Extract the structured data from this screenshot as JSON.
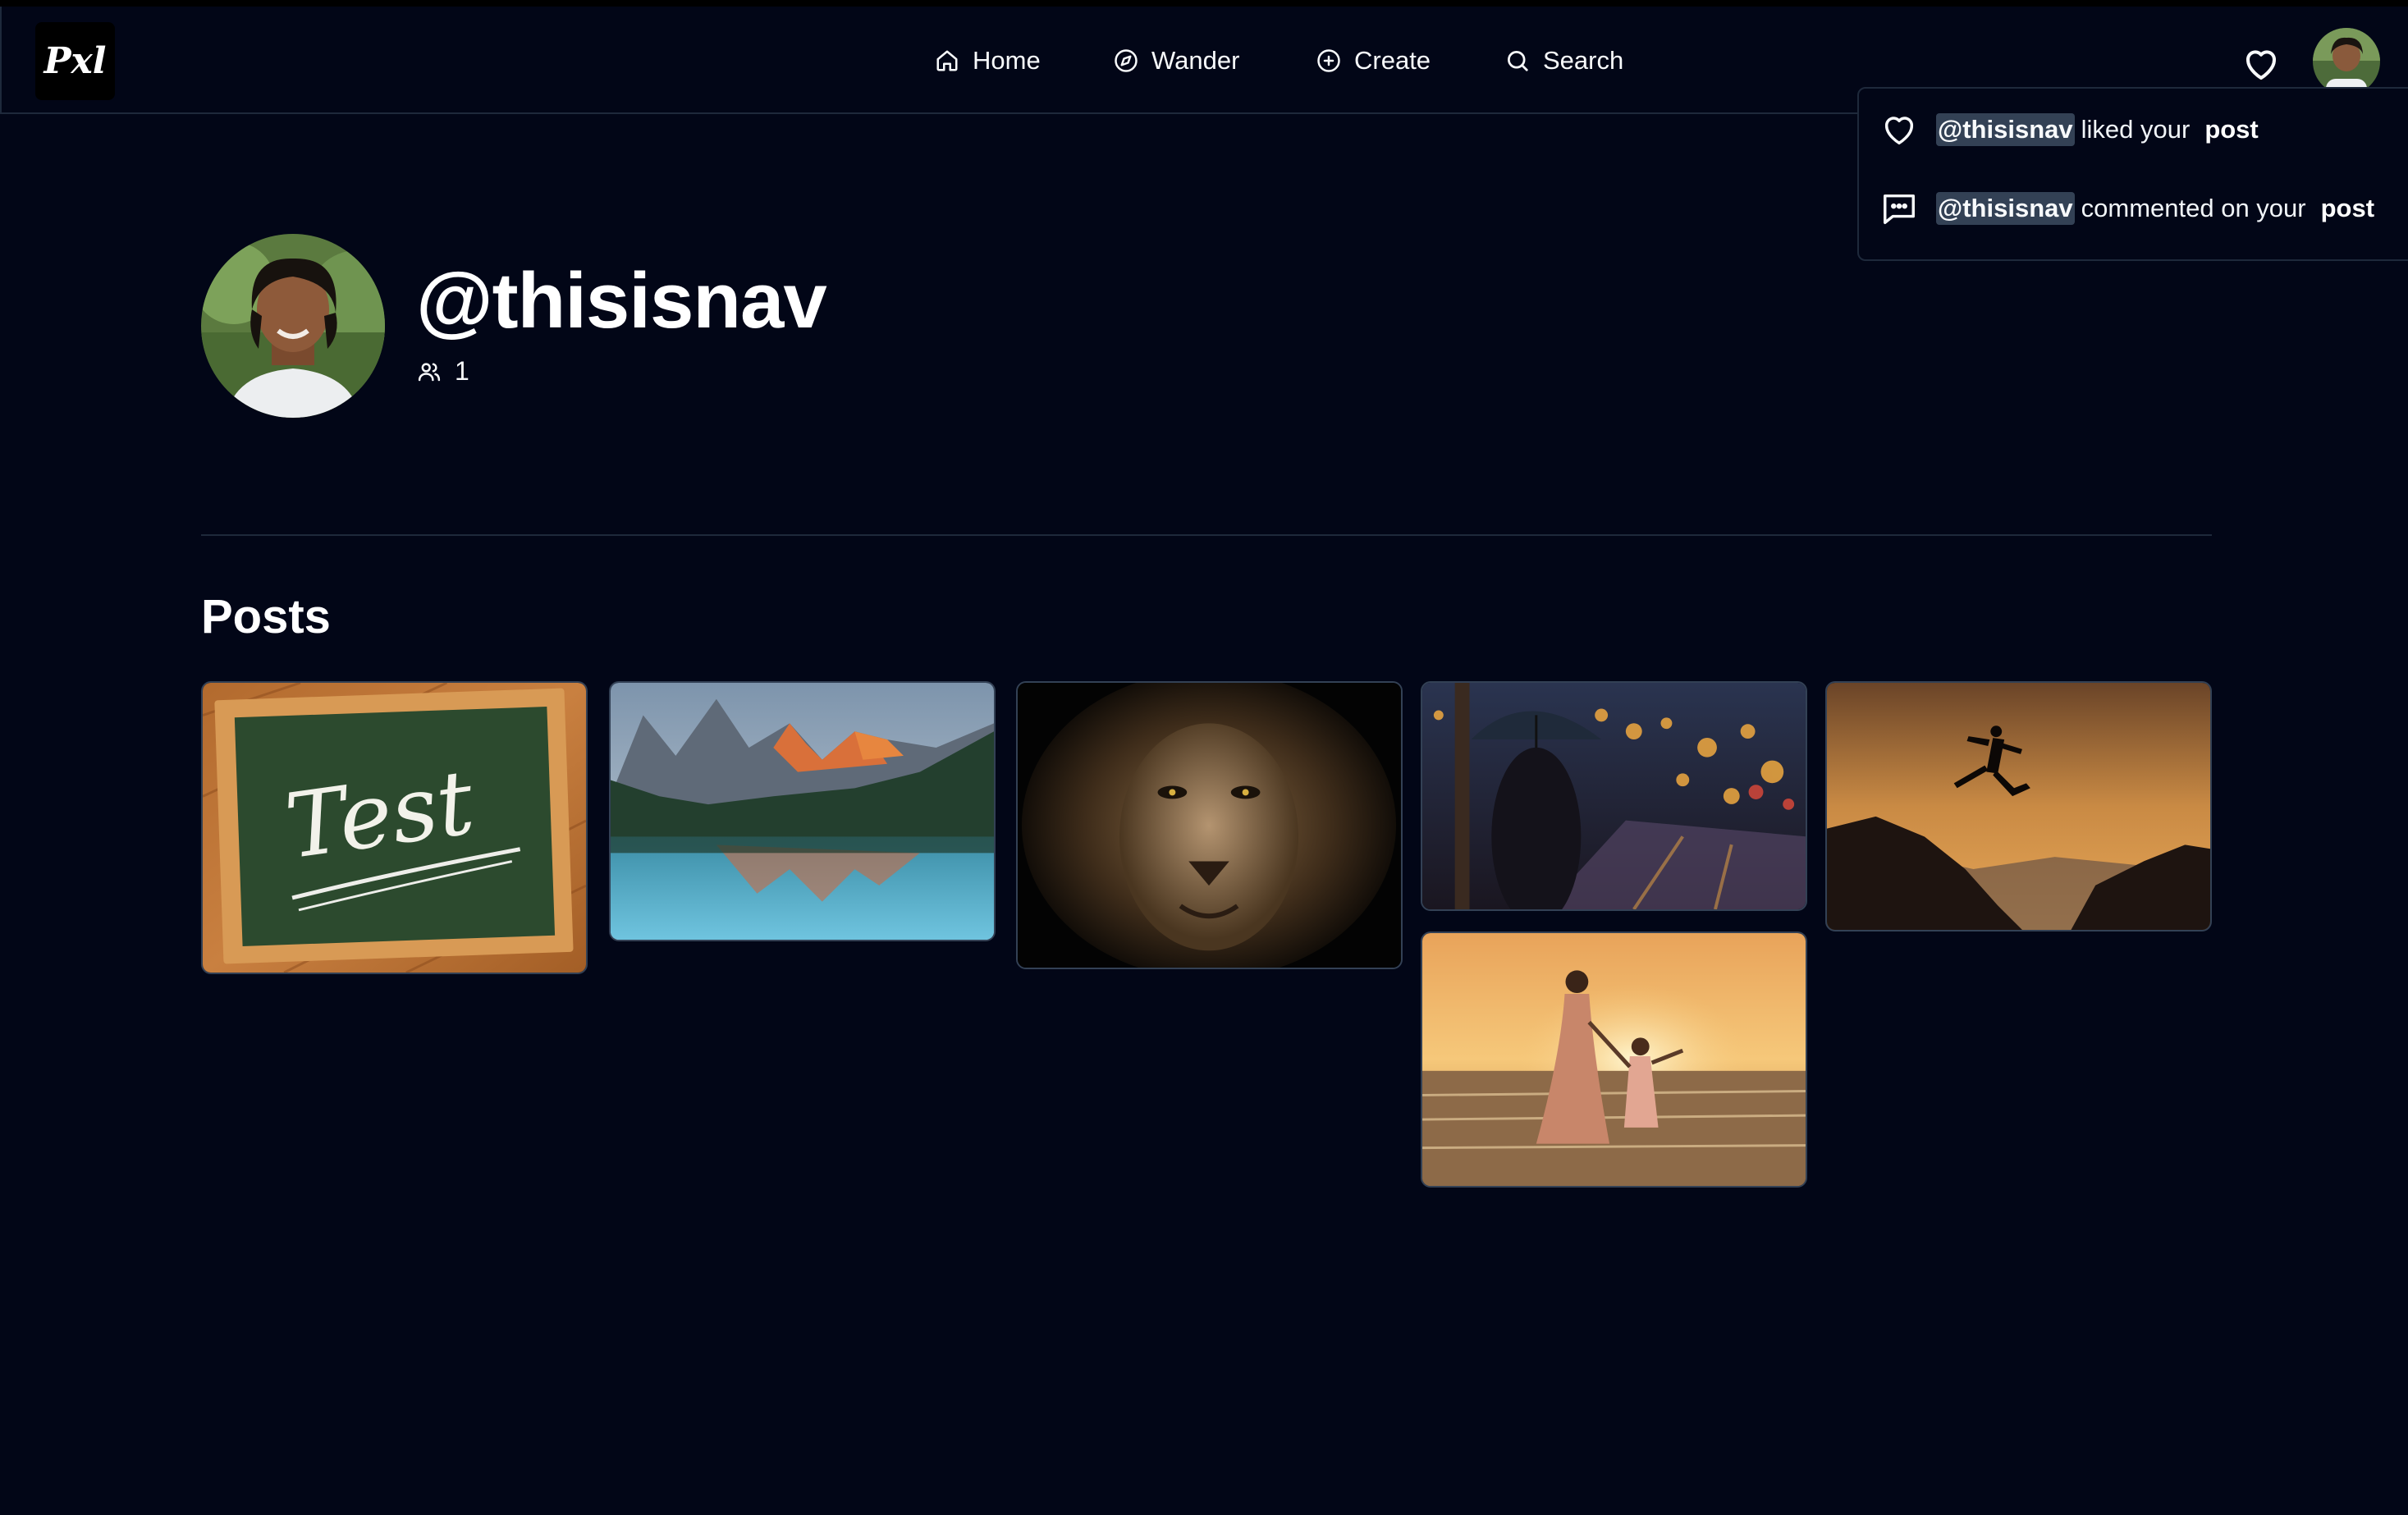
{
  "app": {
    "logo_text": "Pxl"
  },
  "nav": {
    "items": [
      {
        "label": "Home",
        "icon": "home-icon"
      },
      {
        "label": "Wander",
        "icon": "compass-icon"
      },
      {
        "label": "Create",
        "icon": "plus-circle-icon"
      },
      {
        "label": "Search",
        "icon": "search-icon"
      }
    ],
    "notifications_icon": "heart-icon",
    "avatar_icon": "user-avatar"
  },
  "notifications": [
    {
      "icon": "heart-icon",
      "handle": "@thisisnav",
      "text": "liked your",
      "link": "post"
    },
    {
      "icon": "comment-icon",
      "handle": "@thisisnav",
      "text": "commented on your",
      "link": "post"
    }
  ],
  "profile": {
    "username": "@thisisnav",
    "followers_count": "1",
    "followers_icon": "users-icon"
  },
  "posts": {
    "title": "Posts",
    "items": [
      {
        "subject": "chalkboard",
        "board_text": "Test"
      },
      {
        "subject": "mountain-lake"
      },
      {
        "subject": "lion"
      },
      {
        "subject": "umbrella-city-night"
      },
      {
        "subject": "mother-child-beach"
      },
      {
        "subject": "jumping-silhouette-sunset"
      }
    ]
  }
}
